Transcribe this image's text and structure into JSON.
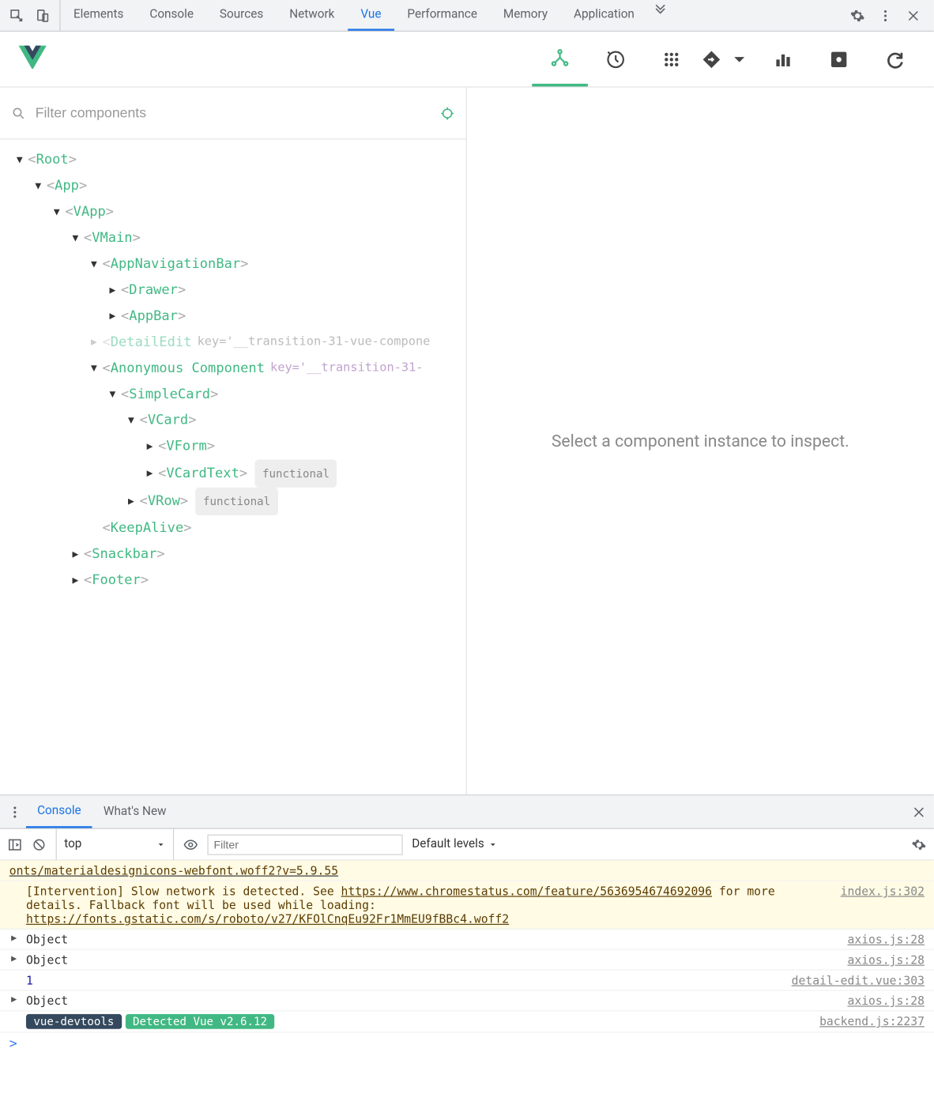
{
  "topTabs": {
    "elements": "Elements",
    "console": "Console",
    "sources": "Sources",
    "network": "Network",
    "vue": "Vue",
    "performance": "Performance",
    "memory": "Memory",
    "application": "Application"
  },
  "filter": {
    "placeholder": "Filter components"
  },
  "tree": {
    "root": "Root",
    "app": "App",
    "vapp": "VApp",
    "vmain": "VMain",
    "appnav": "AppNavigationBar",
    "drawer": "Drawer",
    "appbar": "AppBar",
    "detailedit": "DetailEdit",
    "detailedit_key": "key='__transition-31-vue-compone",
    "anon": "Anonymous Component",
    "anon_key": "key='__transition-31-",
    "simplecard": "SimpleCard",
    "vcard": "VCard",
    "vform": "VForm",
    "vcardtext": "VCardText",
    "vrow": "VRow",
    "functional": "functional",
    "keepalive": "KeepAlive",
    "snackbar": "Snackbar",
    "footer": "Footer"
  },
  "inspector_hint": "Select a component instance to inspect.",
  "drawer": {
    "console": "Console",
    "whatsnew": "What's New",
    "context": "top",
    "filter_placeholder": "Filter",
    "levels": "Default levels"
  },
  "logs": {
    "warn_cut": "onts/materialdesignicons-webfont.woff2?v=5.9.55",
    "warn_text_a": "[Intervention] Slow network is detected. See ",
    "warn_link1": "https://www.chromestatus.com/feature/56369546746920",
    "warn_link1b": "96",
    "warn_text_b": " for more details. Fallback font will be used while loading: ",
    "warn_link2": "https://fonts.gstatic.com/s/roboto/v27/KFOlCnqEu92Fr1MmEU9fBBc4.woff2",
    "warn_src": "index.js:302",
    "obj": "Object",
    "axios_src": "axios.js:28",
    "one": "1",
    "detail_src": "detail-edit.vue:303",
    "vd_label": "vue-devtools",
    "vd_detected": "Detected Vue v2.6.12",
    "backend_src": "backend.js:2237",
    "prompt": ">"
  }
}
